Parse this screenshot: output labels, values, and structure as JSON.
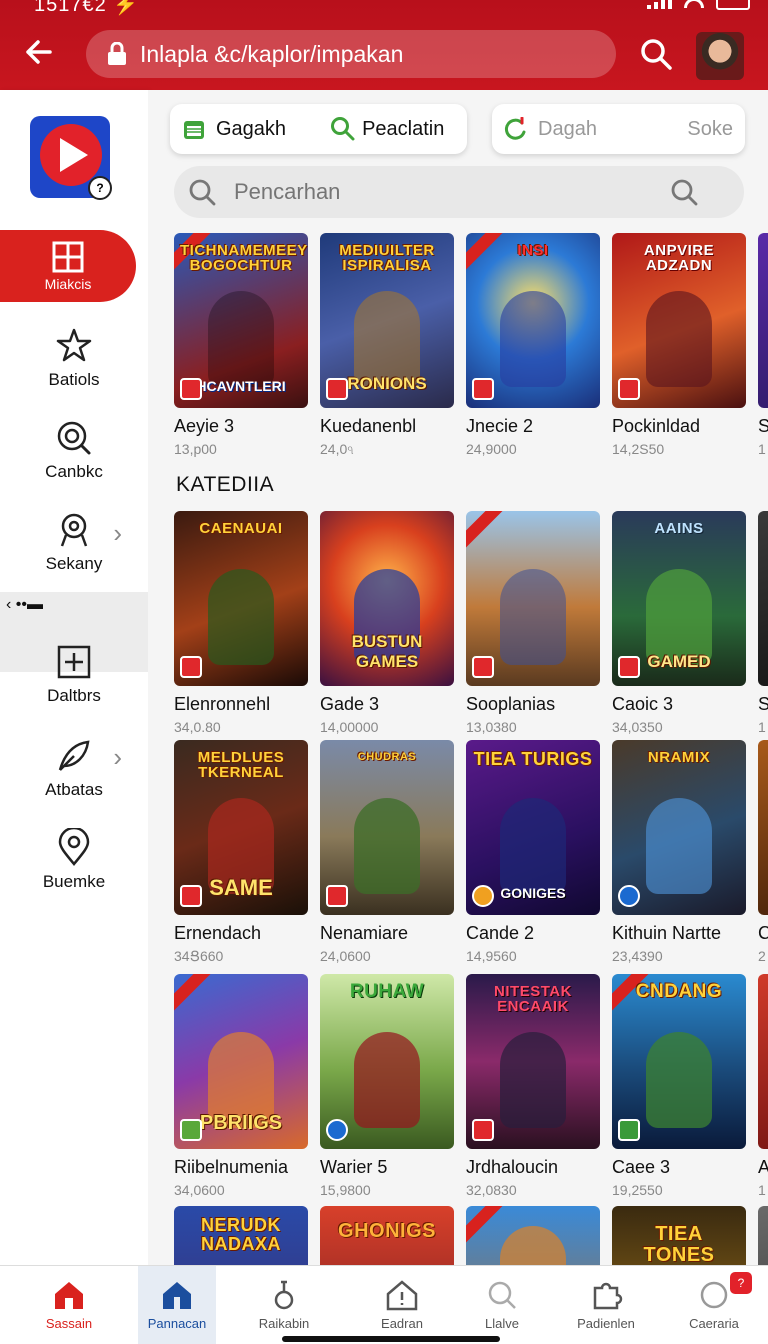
{
  "status_bar": {
    "time": "1517€2 ⚡"
  },
  "header": {
    "url": "Inlapla &c/kaplor/impakan",
    "colors": {
      "primary": "#c8161f"
    }
  },
  "sidebar": {
    "items": [
      {
        "label": "Miakcis",
        "icon": "grid-icon",
        "active": true
      },
      {
        "label": "Batiols",
        "icon": "star-icon"
      },
      {
        "label": "Canbkc",
        "icon": "search-icon"
      },
      {
        "label": "Sekany",
        "icon": "badge-icon",
        "chevron": true
      },
      {
        "label": "Daltbrs",
        "icon": "plus-box-icon"
      },
      {
        "label": "Atbatas",
        "icon": "leaf-icon",
        "chevron": true
      },
      {
        "label": "Buemke",
        "icon": "map-pin-icon"
      }
    ],
    "collapsed_label": "‹ ••▬"
  },
  "filters": {
    "pill1_a": "Gagakh",
    "pill1_b": "Peaclatin",
    "pill2_a": "Dagah",
    "pill2_b": "Soke"
  },
  "search": {
    "placeholder": "Pencarhan"
  },
  "section_title": "KATEDIIA",
  "row1": [
    {
      "title": "Aeyie 3",
      "count": "13,р00",
      "art_top": "TICHNAMEMEEY BOGOCHTUR",
      "art_bottom": "HCAVNTLERI"
    },
    {
      "title": "Kuedanenbl",
      "count": "24,0ঀ",
      "art_top": "MEDIUILTER ISPIRALISA",
      "art_bottom": "RONIONS"
    },
    {
      "title": "Jnecie 2",
      "count": "24,9000",
      "art_top": "INSI",
      "art_bottom": ""
    },
    {
      "title": "Pockinldad",
      "count": "14,2S50",
      "art_top": "ANPVIRE ADZADN",
      "art_bottom": ""
    },
    {
      "title": "S",
      "count": "1",
      "art_top": "",
      "art_bottom": ""
    }
  ],
  "row2": [
    {
      "title": "Elenronnehl",
      "count": "34,0.80",
      "art_top": "CAENAUAI",
      "art_bottom": ""
    },
    {
      "title": "Gade 3",
      "count": "14,00000",
      "art_top": "",
      "art_bottom": "BUSTUN GAMES"
    },
    {
      "title": "Sooplanias",
      "count": "13,0380",
      "art_top": "",
      "art_bottom": ""
    },
    {
      "title": "Caoic 3",
      "count": "34,0350",
      "art_top": "AAINS",
      "art_bottom": "GAMED"
    },
    {
      "title": "S",
      "count": "1",
      "art_top": "",
      "art_bottom": ""
    }
  ],
  "row3": [
    {
      "title": "Ernendach",
      "count": "34Ց660",
      "art_top": "MELDLUES TKERNEAL",
      "art_bottom": "SAME"
    },
    {
      "title": "Nenamiare",
      "count": "24,0600",
      "art_top": "CHUDRAS",
      "art_bottom": ""
    },
    {
      "title": "Cande 2",
      "count": "14,9560",
      "art_top": "TIEA TURIGS",
      "art_bottom": "GONIGES"
    },
    {
      "title": "Kithuin Nartte",
      "count": "23,4390",
      "art_top": "NRAMIX",
      "art_bottom": ""
    },
    {
      "title": "C",
      "count": "2",
      "art_top": "",
      "art_bottom": ""
    }
  ],
  "row4": [
    {
      "title": "Riibelnumenia",
      "count": "34,0600",
      "art_top": "",
      "art_bottom": "PBRIIGS"
    },
    {
      "title": "Warier 5",
      "count": "15,9800",
      "art_top": "RUHAW",
      "art_bottom": ""
    },
    {
      "title": "Jrdhaloucin",
      "count": "32,0830",
      "art_top": "NITESTAK ENCAAIK",
      "art_bottom": ""
    },
    {
      "title": "Caee 3",
      "count": "19,2550",
      "art_top": "CNDANG",
      "art_bottom": ""
    },
    {
      "title": "A",
      "count": "1",
      "art_top": "",
      "art_bottom": ""
    }
  ],
  "row5": [
    {
      "title": "",
      "count": "",
      "art_top": "NERUDK NADAXA",
      "art_bottom": ""
    },
    {
      "title": "",
      "count": "",
      "art_top": "GHONIGS",
      "art_bottom": ""
    },
    {
      "title": "",
      "count": "",
      "art_top": "",
      "art_bottom": ""
    },
    {
      "title": "",
      "count": "",
      "art_top": "TIEA TONES",
      "art_bottom": ""
    },
    {
      "title": "",
      "count": "",
      "art_top": "",
      "art_bottom": ""
    }
  ],
  "bottom_nav": [
    {
      "label": "Sassain",
      "icon": "home-icon"
    },
    {
      "label": "Pannacan",
      "icon": "home-outline-icon"
    },
    {
      "label": "Raikabin",
      "icon": "figure-icon"
    },
    {
      "label": "Eadran",
      "icon": "warning-house-icon"
    },
    {
      "label": "Llalve",
      "icon": "search-icon"
    },
    {
      "label": "Padienlen",
      "icon": "puzzle-icon"
    },
    {
      "label": "Caeraria",
      "icon": "profile-icon",
      "badge": "?"
    }
  ]
}
